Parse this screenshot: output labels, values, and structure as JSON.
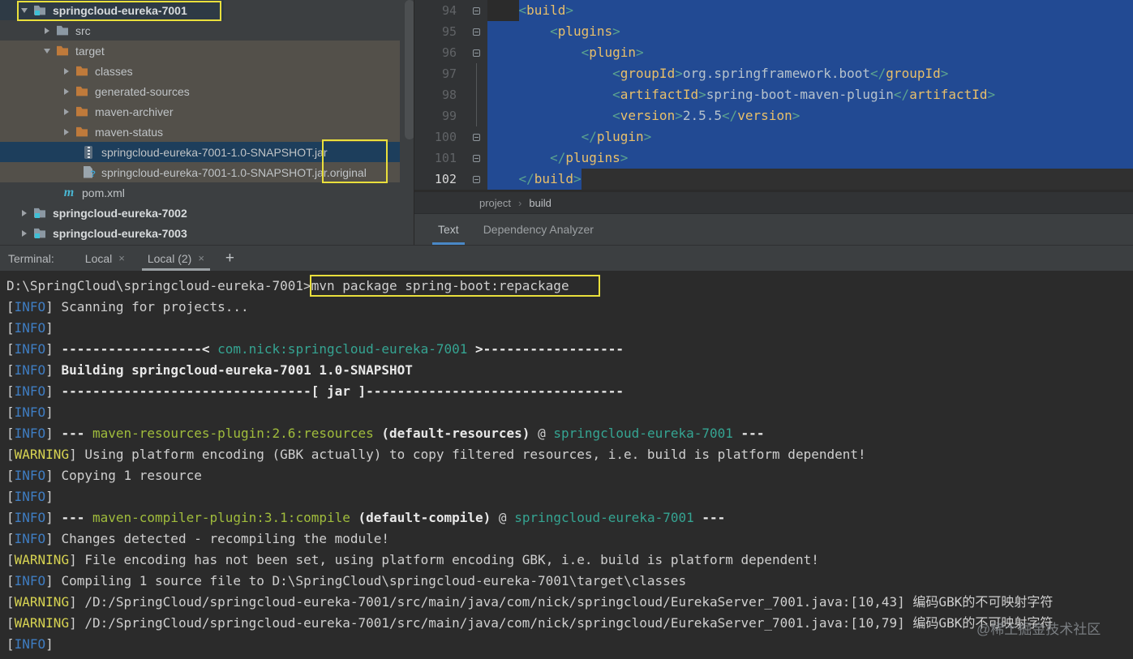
{
  "tree": {
    "items": [
      {
        "label": "springcloud-eureka-7001",
        "arrow": "down",
        "icon": "module",
        "bold": true,
        "pad": 20,
        "row": "root"
      },
      {
        "label": "src",
        "arrow": "right",
        "icon": "folder",
        "pad": 48
      },
      {
        "label": "target",
        "arrow": "down",
        "icon": "folder-orange",
        "pad": 48,
        "row": "olive"
      },
      {
        "label": "classes",
        "arrow": "right",
        "icon": "folder-orange",
        "pad": 72,
        "row": "olive"
      },
      {
        "label": "generated-sources",
        "arrow": "right",
        "icon": "folder-orange",
        "pad": 72,
        "row": "olive"
      },
      {
        "label": "maven-archiver",
        "arrow": "right",
        "icon": "folder-orange",
        "pad": 72,
        "row": "olive"
      },
      {
        "label": "maven-status",
        "arrow": "right",
        "icon": "folder-orange",
        "pad": 72,
        "row": "olive"
      },
      {
        "label": "springcloud-eureka-7001-1.0-SNAPSHOT.jar",
        "icon": "jar",
        "pad": 100,
        "row": "selected"
      },
      {
        "label": "springcloud-eureka-7001-1.0-SNAPSHOT.jar.original",
        "icon": "file-question",
        "pad": 100,
        "row": "olive"
      },
      {
        "label": "pom.xml",
        "icon": "maven",
        "pad": 76
      },
      {
        "label": "springcloud-eureka-7002",
        "arrow": "right",
        "icon": "module",
        "bold": true,
        "pad": 20
      },
      {
        "label": "springcloud-eureka-7003",
        "arrow": "right",
        "icon": "module",
        "bold": true,
        "pad": 20
      }
    ]
  },
  "editor": {
    "lines": [
      {
        "num": "94",
        "indent": 4,
        "fold": "start",
        "sel": "text",
        "tokens": [
          [
            "<",
            "xb"
          ],
          [
            "build",
            "xt"
          ],
          [
            ">",
            "xb"
          ]
        ]
      },
      {
        "num": "95",
        "indent": 8,
        "fold": "start",
        "sel": "full",
        "tokens": [
          [
            "<",
            "xb"
          ],
          [
            "plugins",
            "xt"
          ],
          [
            ">",
            "xb"
          ]
        ]
      },
      {
        "num": "96",
        "indent": 12,
        "fold": "start",
        "sel": "full",
        "tokens": [
          [
            "<",
            "xb"
          ],
          [
            "plugin",
            "xt"
          ],
          [
            ">",
            "xb"
          ]
        ]
      },
      {
        "num": "97",
        "indent": 16,
        "fold": "line",
        "sel": "full",
        "tokens": [
          [
            "<",
            "xb"
          ],
          [
            "groupId",
            "xt"
          ],
          [
            ">",
            "xb"
          ],
          [
            "org.springframework.boot",
            "xv"
          ],
          [
            "</",
            "xb"
          ],
          [
            "groupId",
            "xt"
          ],
          [
            ">",
            "xb"
          ]
        ]
      },
      {
        "num": "98",
        "indent": 16,
        "fold": "line",
        "sel": "full",
        "tokens": [
          [
            "<",
            "xb"
          ],
          [
            "artifactId",
            "xt"
          ],
          [
            ">",
            "xb"
          ],
          [
            "spring-boot-maven-plugin",
            "xv"
          ],
          [
            "</",
            "xb"
          ],
          [
            "artifactId",
            "xt"
          ],
          [
            ">",
            "xb"
          ]
        ]
      },
      {
        "num": "99",
        "indent": 16,
        "fold": "line",
        "sel": "full",
        "tokens": [
          [
            "<",
            "xb"
          ],
          [
            "version",
            "xt"
          ],
          [
            ">",
            "xb"
          ],
          [
            "2.5.5",
            "xv"
          ],
          [
            "</",
            "xb"
          ],
          [
            "version",
            "xt"
          ],
          [
            ">",
            "xb"
          ]
        ]
      },
      {
        "num": "100",
        "indent": 12,
        "fold": "end",
        "sel": "full",
        "tokens": [
          [
            "</",
            "xb"
          ],
          [
            "plugin",
            "xt"
          ],
          [
            ">",
            "xb"
          ]
        ]
      },
      {
        "num": "101",
        "indent": 8,
        "fold": "end",
        "sel": "full",
        "tokens": [
          [
            "</",
            "xb"
          ],
          [
            "plugins",
            "xt"
          ],
          [
            ">",
            "xb"
          ]
        ]
      },
      {
        "num": "102",
        "indent": 4,
        "fold": "end",
        "sel": "end",
        "caret": true,
        "tokens": [
          [
            "</",
            "xb"
          ],
          [
            "build",
            "xt"
          ],
          [
            ">",
            "xb"
          ]
        ]
      }
    ],
    "breadcrumb": {
      "items": [
        "project",
        "build"
      ],
      "separator": "›"
    },
    "tabs": [
      {
        "label": "Text",
        "active": true
      },
      {
        "label": "Dependency Analyzer",
        "active": false
      }
    ]
  },
  "terminal_bar": {
    "label": "Terminal:",
    "tabs": [
      {
        "label": "Local",
        "close": "×",
        "active": false
      },
      {
        "label": "Local (2)",
        "close": "×",
        "active": true
      }
    ],
    "add_button": "+"
  },
  "terminal": {
    "lines": [
      {
        "segs": [
          [
            "D:\\SpringCloud\\springcloud-eureka-7001>",
            "fg"
          ],
          [
            "mvn package spring-boot:repackage",
            "fg"
          ]
        ]
      },
      {
        "level": "INFO",
        "segs": [
          [
            " Scanning for projects...",
            "fg"
          ]
        ]
      },
      {
        "level": "INFO",
        "segs": []
      },
      {
        "level": "INFO",
        "segs": [
          [
            " ------------------< ",
            "b"
          ],
          [
            "com.nick:springcloud-eureka-7001",
            "teal"
          ],
          [
            " >------------------",
            "b"
          ]
        ]
      },
      {
        "level": "INFO",
        "segs": [
          [
            " ",
            "fg"
          ],
          [
            "Building springcloud-eureka-7001 1.0-SNAPSHOT",
            "b"
          ]
        ]
      },
      {
        "level": "INFO",
        "segs": [
          [
            " ",
            "fg"
          ],
          [
            "--------------------------------[ jar ]---------------------------------",
            "b"
          ]
        ]
      },
      {
        "level": "INFO",
        "segs": []
      },
      {
        "level": "INFO",
        "segs": [
          [
            " ",
            "fg"
          ],
          [
            "--- ",
            "b"
          ],
          [
            "maven-resources-plugin:2.6:resources",
            "green"
          ],
          [
            " ",
            "fg"
          ],
          [
            "(default-resources)",
            "b"
          ],
          [
            " @ ",
            "fg"
          ],
          [
            "springcloud-eureka-7001",
            "teal"
          ],
          [
            " ",
            "fg"
          ],
          [
            "---",
            "b"
          ]
        ]
      },
      {
        "level": "WARNING",
        "segs": [
          [
            " Using platform encoding (GBK actually) to copy filtered resources, i.e. build is platform dependent!",
            "fg"
          ]
        ]
      },
      {
        "level": "INFO",
        "segs": [
          [
            " Copying 1 resource",
            "fg"
          ]
        ]
      },
      {
        "level": "INFO",
        "segs": []
      },
      {
        "level": "INFO",
        "segs": [
          [
            " ",
            "fg"
          ],
          [
            "--- ",
            "b"
          ],
          [
            "maven-compiler-plugin:3.1:compile",
            "green"
          ],
          [
            " ",
            "fg"
          ],
          [
            "(default-compile)",
            "b"
          ],
          [
            " @ ",
            "fg"
          ],
          [
            "springcloud-eureka-7001",
            "teal"
          ],
          [
            " ",
            "fg"
          ],
          [
            "---",
            "b"
          ]
        ]
      },
      {
        "level": "INFO",
        "segs": [
          [
            " Changes detected - recompiling the module!",
            "fg"
          ]
        ]
      },
      {
        "level": "WARNING",
        "segs": [
          [
            " File encoding has not been set, using platform encoding GBK, i.e. build is platform dependent!",
            "fg"
          ]
        ]
      },
      {
        "level": "INFO",
        "segs": [
          [
            " Compiling 1 source file to D:\\SpringCloud\\springcloud-eureka-7001\\target\\classes",
            "fg"
          ]
        ]
      },
      {
        "level": "WARNING",
        "segs": [
          [
            " /D:/SpringCloud/springcloud-eureka-7001/src/main/java/com/nick/springcloud/EurekaServer_7001.java:[10,43] 编码GBK的不可映射字符",
            "fg"
          ]
        ]
      },
      {
        "level": "WARNING",
        "segs": [
          [
            " /D:/SpringCloud/springcloud-eureka-7001/src/main/java/com/nick/springcloud/EurekaServer_7001.java:[10,79] 编码GBK的不可映射字符",
            "fg"
          ]
        ]
      },
      {
        "level": "INFO",
        "segs": []
      }
    ]
  },
  "watermark": "@稀土掘金技术社区",
  "colors": {
    "info_blue": "#3f7dc2",
    "warning_yellow": "#d8d452",
    "plugin_green": "#a0bc3c",
    "coordinate_teal": "#35a492",
    "selection_blue": "#224a93",
    "annotation_yellow": "#e9df3c",
    "tag_gold": "#e8bf6a",
    "bracket_green": "#5ba390"
  }
}
